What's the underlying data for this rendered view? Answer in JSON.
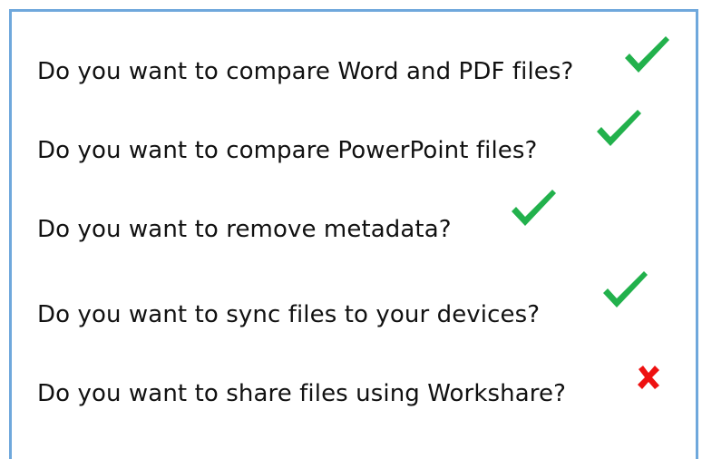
{
  "questions": [
    {
      "text": "Do you want to compare Word and PDF files?",
      "status": "yes",
      "icon": "check-icon"
    },
    {
      "text": "Do you want to compare PowerPoint files?",
      "status": "yes",
      "icon": "check-icon"
    },
    {
      "text": "Do you want to remove metadata?",
      "status": "yes",
      "icon": "check-icon"
    },
    {
      "text": "Do you want to sync files to your devices?",
      "status": "yes",
      "icon": "check-icon"
    },
    {
      "text": "Do you want to share files using Workshare?",
      "status": "no",
      "icon": "cross-icon"
    }
  ],
  "colors": {
    "border": "#6fa8dc",
    "check": "#22b14c",
    "cross": "#ee1111",
    "text": "#111111"
  }
}
